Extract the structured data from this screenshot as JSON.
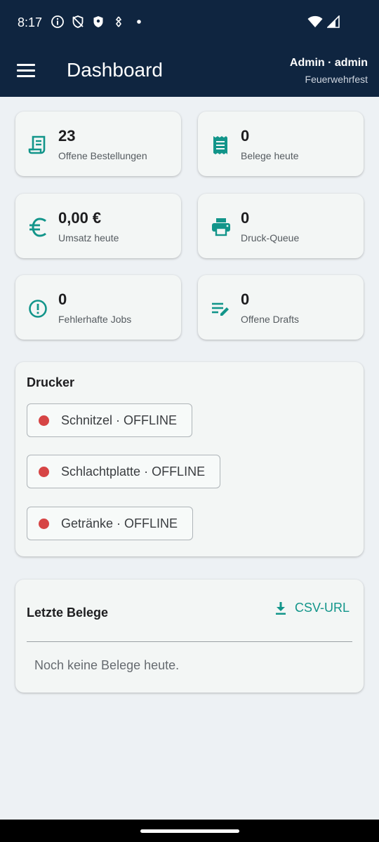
{
  "status_bar": {
    "time": "8:17",
    "icons": [
      "info-icon",
      "shield-off-icon",
      "shield-icon",
      "nfc-icon",
      "dot-icon",
      "wifi-icon",
      "signal-icon"
    ]
  },
  "app_bar": {
    "title": "Dashboard",
    "user": "Admin · admin",
    "event": "Feuerwehrfest"
  },
  "stats": [
    {
      "icon": "receipt-icon",
      "value": "23",
      "label": "Offene Bestellungen"
    },
    {
      "icon": "receipt-long-icon",
      "value": "0",
      "label": "Belege heute"
    },
    {
      "icon": "euro-icon",
      "value": "0,00 €",
      "label": "Umsatz heute"
    },
    {
      "icon": "printer-icon",
      "value": "0",
      "label": "Druck-Queue"
    },
    {
      "icon": "error-icon",
      "value": "0",
      "label": "Fehlerhafte Jobs"
    },
    {
      "icon": "edit-note-icon",
      "value": "0",
      "label": "Offene Drafts"
    }
  ],
  "printers": {
    "title": "Drucker",
    "items": [
      {
        "label": "Schnitzel · OFFLINE",
        "status": "offline"
      },
      {
        "label": "Schlachtplatte · OFFLINE",
        "status": "offline"
      },
      {
        "label": "Getränke · OFFLINE",
        "status": "offline"
      }
    ]
  },
  "receipts": {
    "title": "Letzte Belege",
    "csv_label": "CSV-URL",
    "empty": "Noch keine Belege heute."
  },
  "colors": {
    "header_bg": "#0f2540",
    "accent": "#12958a",
    "offline": "#d64545",
    "page_bg": "#edf1f4"
  }
}
